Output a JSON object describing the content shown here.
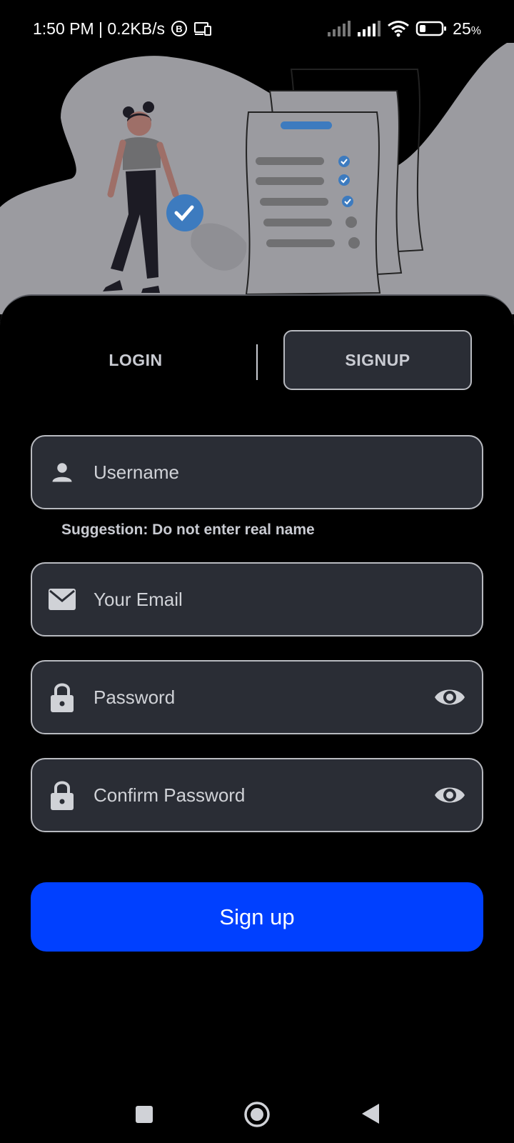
{
  "status_bar": {
    "time": "1:50 PM | 0.2KB/s",
    "battery_percent": "25",
    "battery_unit": "%"
  },
  "tabs": {
    "login_label": "LOGIN",
    "signup_label": "SIGNUP",
    "active": "signup"
  },
  "form": {
    "username_placeholder": "Username",
    "username_value": "",
    "suggestion": "Suggestion: Do not enter real name",
    "email_placeholder": "Your Email",
    "email_value": "",
    "password_placeholder": "Password",
    "password_value": "",
    "confirm_placeholder": "Confirm Password",
    "confirm_value": "",
    "submit_label": "Sign up"
  },
  "colors": {
    "background": "#000000",
    "field_bg": "#2a2d35",
    "field_border": "#b8bac0",
    "primary": "#0040ff",
    "check_accent": "#3d7bbf"
  },
  "icons": {
    "username": "person-icon",
    "email": "mail-icon",
    "password": "lock-icon",
    "toggle": "eye-icon"
  }
}
